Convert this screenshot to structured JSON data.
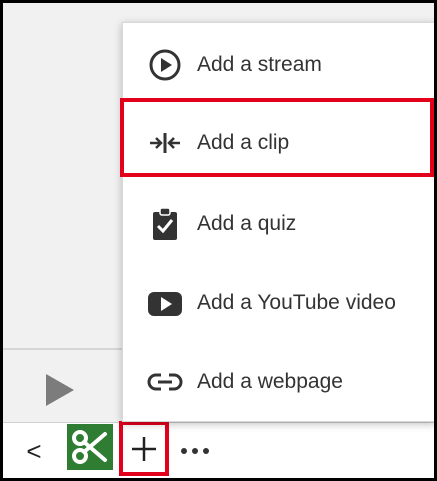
{
  "menu": {
    "items": [
      {
        "label": "Add a stream",
        "icon": "play-circle-icon"
      },
      {
        "label": "Add a clip",
        "icon": "clip-insert-icon"
      },
      {
        "label": "Add a quiz",
        "icon": "clipboard-check-icon"
      },
      {
        "label": "Add a YouTube video",
        "icon": "youtube-icon"
      },
      {
        "label": "Add a webpage",
        "icon": "link-icon"
      }
    ]
  },
  "toolbar": {
    "prev_glyph": "<",
    "add_glyph": "+",
    "icons": [
      "chevron-left-icon",
      "scissors-icon",
      "plus-icon",
      "more-icon"
    ]
  },
  "colors": {
    "highlight": "#e3001b",
    "scissors_bg": "#2f7d32",
    "text": "#333333"
  }
}
